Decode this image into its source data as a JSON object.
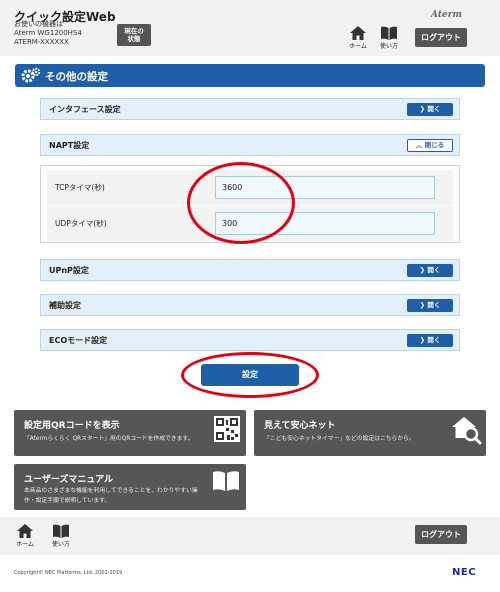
{
  "header": {
    "app_title": "クイック設定Web",
    "device_caption": "お使いの機器は",
    "device_model": "Aterm WG1200HS4",
    "device_id": "ATERM-XXXXXX",
    "status_button_line1": "現在の",
    "status_button_line2": "状態",
    "brand": "Aterm",
    "home_label": "ホーム",
    "manual_label": "使い方",
    "logout_label": "ログアウト"
  },
  "section": {
    "title": "その他の設定"
  },
  "accordions": {
    "interface": {
      "title": "インタフェース設定",
      "button": "開く"
    },
    "napt": {
      "title": "NAPT設定",
      "button": "閉じる"
    },
    "upnp": {
      "title": "UPnP設定",
      "button": "開く"
    },
    "assist": {
      "title": "補助設定",
      "button": "開く"
    },
    "eco": {
      "title": "ECOモード設定",
      "button": "開く"
    }
  },
  "napt_fields": {
    "tcp": {
      "label": "TCPタイマ(秒)",
      "value": "3600"
    },
    "udp": {
      "label": "UDPタイマ(秒)",
      "value": "300"
    }
  },
  "submit_label": "設定",
  "tiles": {
    "qr": {
      "title": "設定用QRコードを表示",
      "desc": "「Atermらくらく QRスタート」用のQRコードを作成できます。"
    },
    "safe": {
      "title": "見えて安心ネット",
      "desc": "「こども安心ネットタイマー」などの設定はこちらから。"
    },
    "manual": {
      "title": "ユーザーズマニュアル",
      "desc1": "本商品のさまざまな機能を利用してできることを、わかりやすい操",
      "desc2": "作・設定手順で説明しています。"
    }
  },
  "footer": {
    "home_label": "ホーム",
    "manual_label": "使い方",
    "logout_label": "ログアウト",
    "copyright": "Copyright© NEC Platforms, Ltd. 2001-2019",
    "nec_logo": "NEC"
  },
  "colors": {
    "accent_blue": "#1f5fa8",
    "annotation_red": "#e50012",
    "tile_gray": "#565656"
  }
}
